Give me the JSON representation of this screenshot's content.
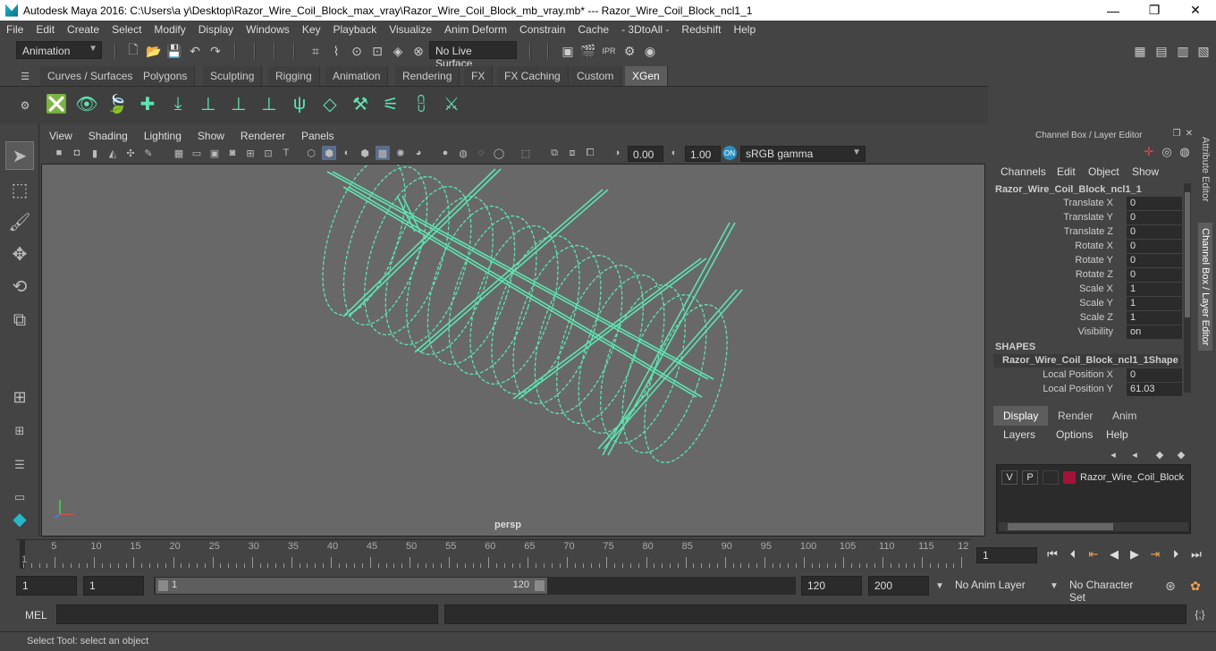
{
  "window": {
    "title": "Autodesk Maya 2016: C:\\Users\\a y\\Desktop\\Razor_Wire_Coil_Block_max_vray\\Razor_Wire_Coil_Block_mb_vray.mb*   ---   Razor_Wire_Coil_Block_ncl1_1",
    "minimize": "—",
    "maximize": "❐",
    "close": "✕"
  },
  "menubar": [
    "File",
    "Edit",
    "Create",
    "Select",
    "Modify",
    "Display",
    "Windows",
    "Key",
    "Playback",
    "Visualize",
    "Anim Deform",
    "Constrain",
    "Cache",
    "- 3DtoAll -",
    "Redshift",
    "Help"
  ],
  "statusline": {
    "menuset": "Animation",
    "live_surface": "No Live Surface"
  },
  "shelf_tabs": [
    {
      "label": "Curves / Surfaces"
    },
    {
      "label": "Polygons"
    },
    {
      "label": "Sculpting"
    },
    {
      "label": "Rigging"
    },
    {
      "label": "Animation"
    },
    {
      "label": "Rendering"
    },
    {
      "label": "FX"
    },
    {
      "label": "FX Caching"
    },
    {
      "label": "Custom"
    },
    {
      "label": "XGen",
      "active": true
    }
  ],
  "panel_menu": [
    "View",
    "Shading",
    "Lighting",
    "Show",
    "Renderer",
    "Panels"
  ],
  "panel_toolbar": {
    "exposure": "0.00",
    "gamma": "1.00",
    "color_space": "sRGB gamma"
  },
  "viewport": {
    "camera_label": "persp",
    "wire_color": "#5fe3b0"
  },
  "channel_box": {
    "header": "Channel Box / Layer Editor",
    "menus": [
      "Channels",
      "Edit",
      "Object",
      "Show"
    ],
    "object_name": "Razor_Wire_Coil_Block_ncl1_1",
    "channels": [
      {
        "label": "Translate X",
        "value": "0"
      },
      {
        "label": "Translate Y",
        "value": "0"
      },
      {
        "label": "Translate Z",
        "value": "0"
      },
      {
        "label": "Rotate X",
        "value": "0"
      },
      {
        "label": "Rotate Y",
        "value": "0"
      },
      {
        "label": "Rotate Z",
        "value": "0"
      },
      {
        "label": "Scale X",
        "value": "1"
      },
      {
        "label": "Scale Y",
        "value": "1"
      },
      {
        "label": "Scale Z",
        "value": "1"
      },
      {
        "label": "Visibility",
        "value": "on"
      }
    ],
    "shapes_header": "SHAPES",
    "shape_name": "Razor_Wire_Coil_Block_ncl1_1Shape",
    "shape_channels": [
      {
        "label": "Local Position X",
        "value": "0"
      },
      {
        "label": "Local Position Y",
        "value": "61.03"
      }
    ]
  },
  "layer_editor": {
    "tabs": [
      {
        "label": "Display",
        "active": true
      },
      {
        "label": "Render"
      },
      {
        "label": "Anim"
      }
    ],
    "menus": [
      "Layers",
      "Options",
      "Help"
    ],
    "layer": {
      "v": "V",
      "p": "P",
      "color": "#a3123a",
      "name": "Razor_Wire_Coil_Block"
    }
  },
  "side_tabs": [
    "Attribute Editor",
    "Channel Box / Layer Editor"
  ],
  "timeline": {
    "start_label": "1",
    "tick_labels": [
      "5",
      "10",
      "15",
      "20",
      "25",
      "30",
      "35",
      "40",
      "45",
      "50",
      "55",
      "60",
      "65",
      "70",
      "75",
      "80",
      "85",
      "90",
      "95",
      "100",
      "105",
      "110",
      "115",
      "12"
    ],
    "current_frame": "1"
  },
  "range": {
    "start": "1",
    "anim_start": "1",
    "range_start_label": "1",
    "range_end_label": "120",
    "range_end": "120",
    "anim_end": "200",
    "anim_layer": "No Anim Layer",
    "character_set": "No Character Set"
  },
  "command": {
    "mode": "MEL"
  },
  "help_line": "Select Tool: select an object"
}
